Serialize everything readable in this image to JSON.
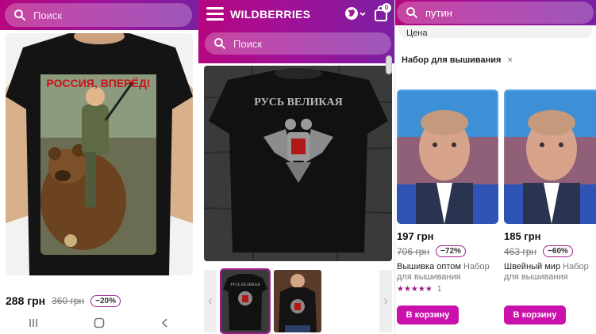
{
  "screen1": {
    "search": {
      "placeholder": "Поиск"
    },
    "shirt_text": "РОССИЯ, ВПЕРЁД!",
    "product": {
      "price": "288 грн",
      "old_price": "360 грн",
      "discount": "−20%"
    },
    "nav": {
      "recent_icon": "recents-icon",
      "home_icon": "home-icon",
      "back_icon": "back-icon"
    }
  },
  "screen2": {
    "logo": "WILDBERRIES",
    "cart_count": "0",
    "search": {
      "placeholder": "Поиск"
    },
    "shirt_text": "РУСЬ ВЕЛИКАЯ",
    "thumb_text": "РУСЬ ВЕЛИКАЯ"
  },
  "screen3": {
    "search": {
      "query": "путин"
    },
    "prev_filter": "Цена",
    "active_filter": "Набор для вышивания",
    "remove_filter_symbol": "×",
    "products": [
      {
        "price": "197 грн",
        "old_price": "706 грн",
        "discount": "−72%",
        "brand": "Вышивка оптом",
        "category": "Набор для вышивания",
        "stars": "★★★★★",
        "reviews": "1",
        "cart_label": "В корзину"
      },
      {
        "price": "185 грн",
        "old_price": "463 грн",
        "discount": "−60%",
        "brand": "Швейный мир",
        "category": "Набор для вышивания",
        "stars": "",
        "reviews": "",
        "cart_label": "В корзину"
      }
    ]
  },
  "colors": {
    "brand_pink": "#cb11ab",
    "brand_purple": "#7b1fa2",
    "accent": "#a01d8f"
  }
}
